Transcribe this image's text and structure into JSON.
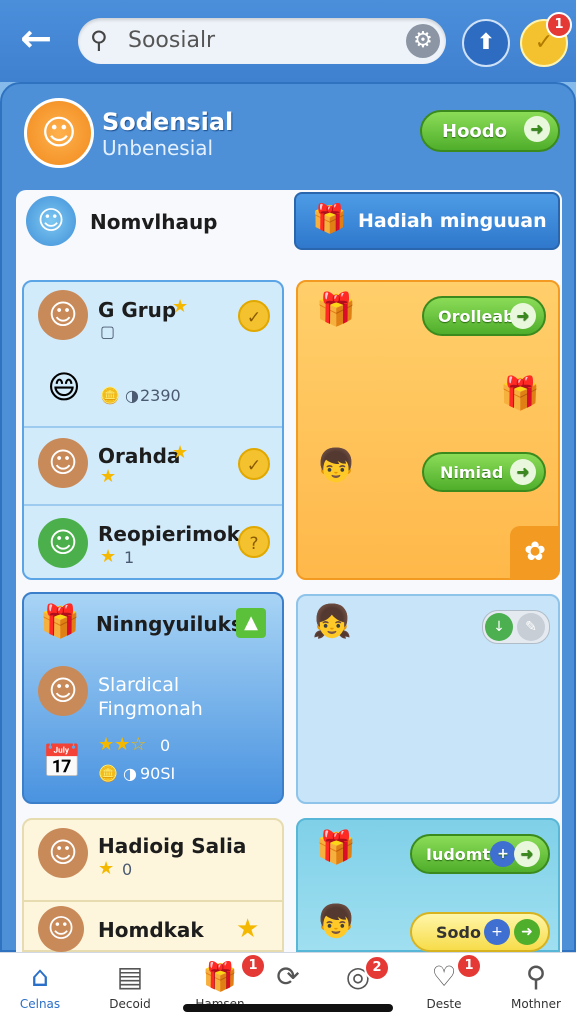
{
  "search": {
    "value": "Soosialr"
  },
  "badges": {
    "top_check": "1"
  },
  "profile": {
    "title": "Sodensial",
    "subtitle": "Unbenesial",
    "button_label": "Hoodo"
  },
  "section": {
    "title": "Nomvlhaup",
    "tab_label": "Hadiah minguuan"
  },
  "left_list": [
    {
      "name": "G Grup",
      "stats": "2390"
    },
    {
      "name": "Orahda"
    },
    {
      "name": "Reopierimok",
      "count": "1"
    }
  ],
  "right_card1": {
    "btn1": "Orolleab",
    "btn2": "Nimiad"
  },
  "card2": {
    "title": "Ninngyuiluks",
    "name1": "Slardical",
    "name2": "Fingmonah",
    "rating_value": "0",
    "stats": "90SI"
  },
  "card3": [
    {
      "name": "Hadioig Salia",
      "count": "0"
    },
    {
      "name": "Homdkak"
    }
  ],
  "right_card3": {
    "btn1": "Iudomt",
    "btn2": "Sodo"
  },
  "nav": [
    {
      "label": "Celnas",
      "icon": "home-icon"
    },
    {
      "label": "Decoid",
      "icon": "document-icon"
    },
    {
      "label": "Hamsen",
      "icon": "gift-icon",
      "badge": "1"
    },
    {
      "label": "",
      "icon": "refresh-icon"
    },
    {
      "label": "",
      "icon": "coins-icon",
      "badge": "2"
    },
    {
      "label": "Deste",
      "icon": "heart-icon",
      "badge": "1"
    },
    {
      "label": "Mothner",
      "icon": "search-icon"
    }
  ]
}
